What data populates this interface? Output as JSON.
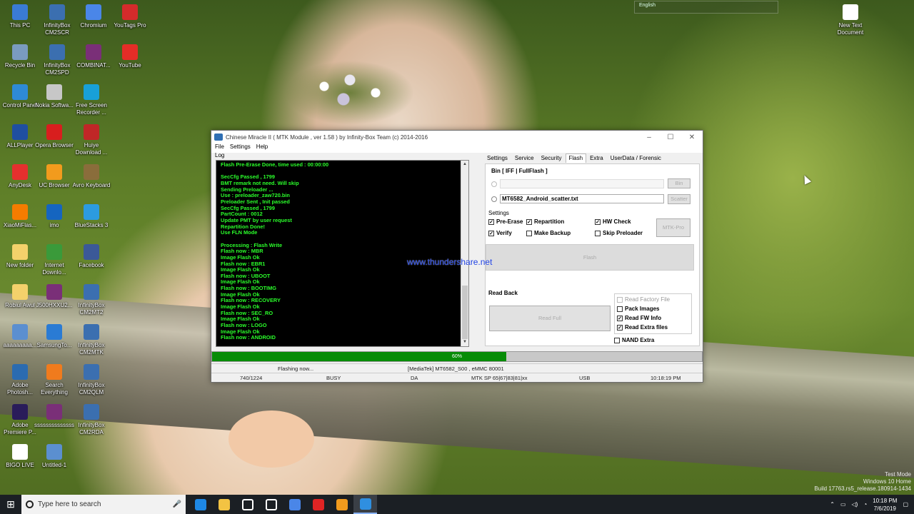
{
  "desktop": {
    "icons": [
      {
        "label": "This PC",
        "icon": "computer-icon",
        "color": "#3a7bd5"
      },
      {
        "label": "InfinityBox CM2SCR",
        "icon": "infinitybox-icon",
        "color": "#3b6fb0"
      },
      {
        "label": "Chromium",
        "icon": "chromium-icon",
        "color": "#4a86e8"
      },
      {
        "label": "YouTags Pro",
        "icon": "youtags-icon",
        "color": "#d52b2b"
      },
      {
        "label": "Recycle Bin",
        "icon": "recycle-bin-icon",
        "color": "#7a9bbf"
      },
      {
        "label": "InfinityBox CM2SPD",
        "icon": "infinitybox-icon",
        "color": "#3b6fb0"
      },
      {
        "label": "COMBINAT...",
        "icon": "winrar-icon",
        "color": "#7a2f78"
      },
      {
        "label": "YouTube",
        "icon": "youtube-icon",
        "color": "#e52d27"
      },
      {
        "label": "Control Panel",
        "icon": "control-panel-icon",
        "color": "#2e8ad6"
      },
      {
        "label": "Nokia Softwa...",
        "icon": "nokia-icon",
        "color": "#c7c7c7"
      },
      {
        "label": "Free Screen Recorder ...",
        "icon": "screen-recorder-icon",
        "color": "#18a0d8"
      },
      {
        "label": "ALLPlayer",
        "icon": "allplayer-icon",
        "color": "#1f4fa0"
      },
      {
        "label": "Opera Browser",
        "icon": "opera-icon",
        "color": "#d81e1e"
      },
      {
        "label": "Huiye Download ...",
        "icon": "huiye-icon",
        "color": "#c02727"
      },
      {
        "label": "AnyDesk",
        "icon": "anydesk-icon",
        "color": "#e5302e"
      },
      {
        "label": "UC Browser",
        "icon": "uc-browser-icon",
        "color": "#f29b1d"
      },
      {
        "label": "Avro Keyboard",
        "icon": "avro-icon",
        "color": "#8a6d3b"
      },
      {
        "label": "XiaoMiFlas...",
        "icon": "xiaomi-icon",
        "color": "#f57c00"
      },
      {
        "label": "imo",
        "icon": "imo-icon",
        "color": "#1565c0"
      },
      {
        "label": "BlueStacks 3",
        "icon": "bluestacks-icon",
        "color": "#2c9be0"
      },
      {
        "label": "New folder",
        "icon": "folder-icon",
        "color": "#f3d16b"
      },
      {
        "label": "Internet Downlo...",
        "icon": "idm-icon",
        "color": "#3a9a3a"
      },
      {
        "label": "Facebook",
        "icon": "facebook-icon",
        "color": "#3b5998"
      },
      {
        "label": "Robiul Awul",
        "icon": "folder-icon",
        "color": "#f3d16b"
      },
      {
        "label": "J500HXXU2...",
        "icon": "winrar-icon",
        "color": "#7a2f78"
      },
      {
        "label": "InfinityBox CM2MT2",
        "icon": "infinitybox-icon",
        "color": "#3b6fb0"
      },
      {
        "label": "aaaaaaaaa...",
        "icon": "image-icon",
        "color": "#5b8fd0"
      },
      {
        "label": "SamsungTo...",
        "icon": "samsung-tool-icon",
        "color": "#2a7bd4"
      },
      {
        "label": "InfinityBox CM2MTK",
        "icon": "infinitybox-icon",
        "color": "#3b6fb0"
      },
      {
        "label": "Adobe Photosh...",
        "icon": "photoshop-icon",
        "color": "#2b6bb0"
      },
      {
        "label": "Search Everything",
        "icon": "search-everything-icon",
        "color": "#f07b1d"
      },
      {
        "label": "InfinityBox CM2QLM",
        "icon": "infinitybox-icon",
        "color": "#3b6fb0"
      },
      {
        "label": "Adobe Premiere P...",
        "icon": "premiere-icon",
        "color": "#2a1c5a"
      },
      {
        "label": "ssssssssssssss",
        "icon": "winrar-icon",
        "color": "#7a2f78"
      },
      {
        "label": "InfinityBox CM2RDA",
        "icon": "infinitybox-icon",
        "color": "#3b6fb0"
      },
      {
        "label": "BIGO LIVE",
        "icon": "bigo-icon",
        "color": "#ffffff"
      },
      {
        "label": "Untitled-1",
        "icon": "image-icon",
        "color": "#5b8fd0"
      },
      {
        "label": "New Text Document",
        "icon": "text-document-icon",
        "color": "#ffffff"
      }
    ],
    "language_bar": {
      "label": "English"
    },
    "watermark": "www.thundershare.net",
    "windows_info": [
      "Test Mode",
      "Windows 10 Home",
      "Build 17763.rs5_release.180914-1434"
    ]
  },
  "window": {
    "title": "Chinese Miracle II ( MTK Module , ver 1.58 ) by Infinity-Box Team (c) 2014-2016",
    "menu": [
      "File",
      "Settings",
      "Help"
    ],
    "log_label": "Log",
    "log_lines": [
      "Flash Pre-Erase Done, time used : 00:00:00",
      "",
      "SecCfg Passed , 1799",
      "BMT remark not need. Will skip",
      "Sending Preloader ...",
      "Use : preloader_zaw720.bin",
      "Preloader Sent , Init passed",
      "SecCfg Passed , 1799",
      "PartCount : 0012",
      "Update PMT by user request",
      "Repartition Done!",
      "Use FLN Mode",
      "",
      "Processing : Flash Write",
      "Flash now : MBR",
      "Image Flash Ok",
      "Flash now : EBR1",
      "Image Flash Ok",
      "Flash now : UBOOT",
      "Image Flash Ok",
      "Flash now : BOOTIMG",
      "Image Flash Ok",
      "Flash now : RECOVERY",
      "Image Flash Ok",
      "Flash now : SEC_RO",
      "Image Flash Ok",
      "Flash now : LOGO",
      "Image Flash Ok",
      "Flash now : ANDROID"
    ],
    "tabs": [
      "Settings",
      "Service",
      "Security",
      "Flash",
      "Extra",
      "UserData / Forensic"
    ],
    "active_tab": "Flash",
    "bin_section": "Bin  [ IFF | FullFlash ]",
    "bin_input": "",
    "bin_button": "Bin",
    "scatter_input": "MT6582_Android_scatter.txt",
    "scatter_button": "Scatter",
    "settings_section": "Settings",
    "settings_checks": [
      {
        "label": "Pre-Erase",
        "checked": true
      },
      {
        "label": "Repartition",
        "checked": true
      },
      {
        "label": "HW Check",
        "checked": true
      },
      {
        "label": "Verify",
        "checked": true
      },
      {
        "label": "Make Backup",
        "checked": false
      },
      {
        "label": "Skip Preloader",
        "checked": false
      }
    ],
    "mtk_pro_button": "MTK-Pro",
    "flash_button": "Flash",
    "readback_section": "Read Back",
    "read_full_button": "Read Full",
    "readback_checks": [
      {
        "label": "Read Factory File",
        "checked": false,
        "disabled": true
      },
      {
        "label": "Pack Images",
        "checked": false,
        "disabled": false
      },
      {
        "label": "Read FW Info",
        "checked": true,
        "disabled": false
      },
      {
        "label": "Read Extra files",
        "checked": true,
        "disabled": false
      }
    ],
    "nand_extra": {
      "label": "NAND Extra",
      "checked": false
    },
    "progress": {
      "value": 0.6,
      "text": "60%"
    },
    "status_row1": {
      "message": "Flashing now...",
      "device": "[MediaTek] MT6582_S00 , eMMC 80001"
    },
    "status_row2": {
      "counter": "740/1224",
      "state": "BUSY",
      "mode": "DA",
      "sp": "MTK SP 65|67|83|81|xx",
      "port": "USB",
      "time": "10:18:19 PM"
    }
  },
  "taskbar": {
    "search_placeholder": "Type here to search",
    "apps": [
      {
        "icon": "edge-icon",
        "color": "#1e88e5"
      },
      {
        "icon": "file-explorer-icon",
        "color": "#f3c343"
      },
      {
        "icon": "store-icon",
        "color": "#ffffff"
      },
      {
        "icon": "mail-icon",
        "color": "#ffffff"
      },
      {
        "icon": "chromium-icon",
        "color": "#4a86e8"
      },
      {
        "icon": "opera-icon",
        "color": "#e02424"
      },
      {
        "icon": "uc-browser-icon",
        "color": "#f29b1d"
      },
      {
        "icon": "cm2-icon",
        "color": "#2f8fe0"
      }
    ],
    "time": "10:18 PM",
    "date": "7/6/2019"
  }
}
